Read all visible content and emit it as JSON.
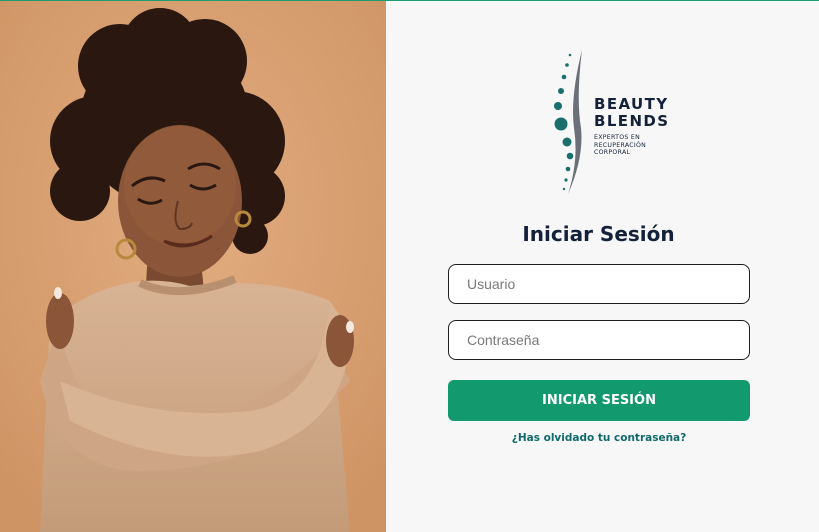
{
  "brand": {
    "line1": "BEAUTY",
    "line2": "BLENDS",
    "tagline": "EXPERTOS EN RECUPERACIÓN CORPORAL",
    "accent_color": "#129a6e",
    "navy_color": "#14213a",
    "teal_color": "#1a6e6e"
  },
  "hero_image": {
    "description_icon": "woman-hugging-self-photo"
  },
  "login": {
    "title": "Iniciar Sesión",
    "username_placeholder": "Usuario",
    "username_value": "",
    "password_placeholder": "Contraseña",
    "password_value": "",
    "submit_label": "INICIAR SESIÓN",
    "forgot_label": "¿Has olvidado tu contraseña?"
  }
}
